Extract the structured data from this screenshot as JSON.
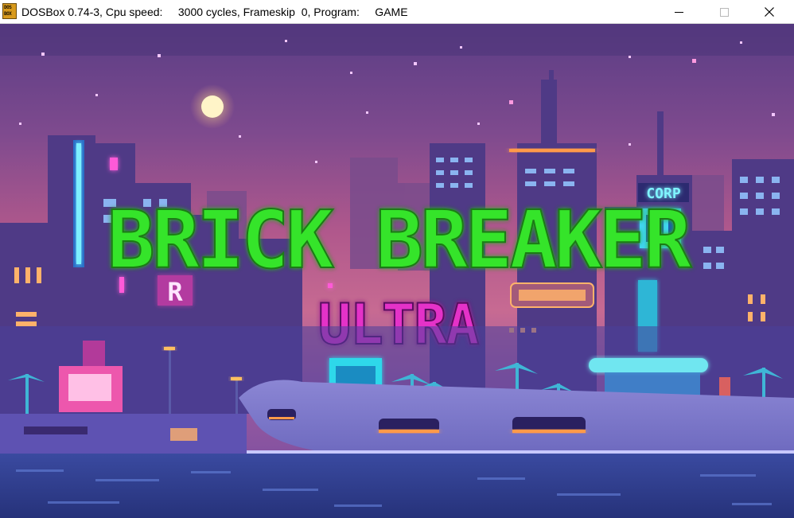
{
  "window": {
    "icon_text_top": "DOS",
    "icon_text_bottom": "BOX",
    "title": "DOSBox 0.74-3, Cpu speed:     3000 cycles, Frameskip  0, Program:     GAME"
  },
  "controls": {
    "minimize": "minimize",
    "maximize": "maximize",
    "close": "close"
  },
  "game": {
    "title_line1": "BRICK BREAKER",
    "title_line2": "ULTRA",
    "sign_corp": "CORP",
    "sign_r": "R"
  },
  "colors": {
    "title_green": "#35e42a",
    "title_magenta": "#e430c8",
    "sky_top": "#5a3d85",
    "sky_bottom": "#c55e86",
    "water": "#2e3f8e",
    "neon_cyan": "#3de3f0"
  }
}
